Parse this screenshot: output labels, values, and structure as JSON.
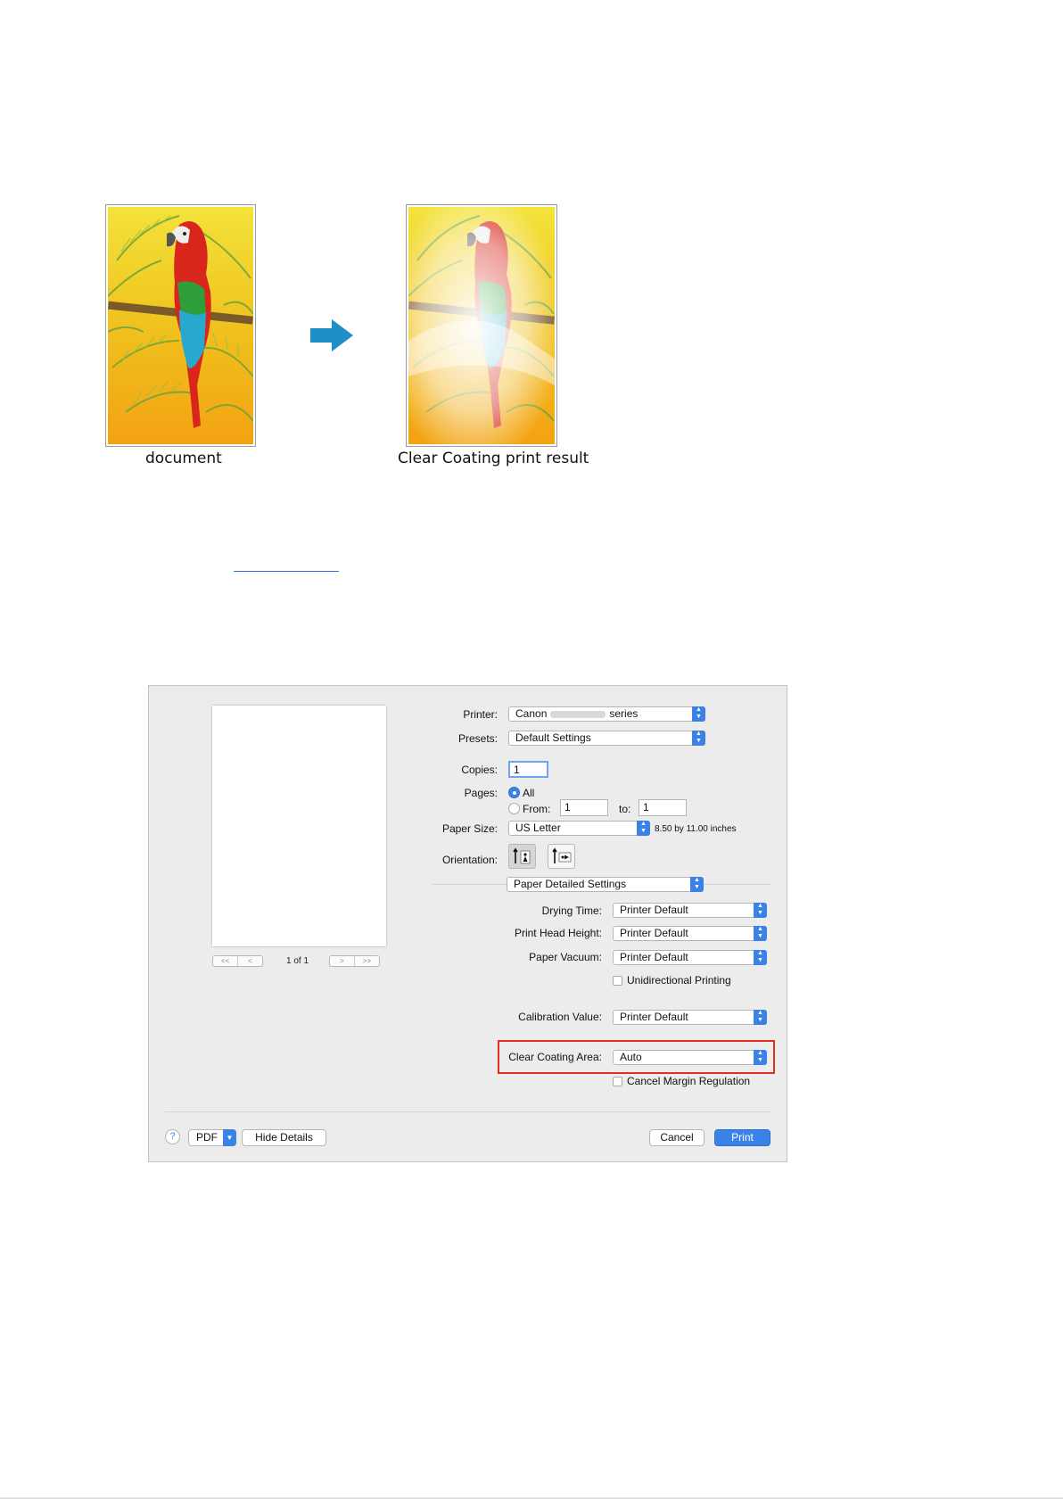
{
  "figure": {
    "caption_left": "document",
    "caption_right": "Clear Coating print result"
  },
  "dialog": {
    "printer": {
      "label": "Printer:",
      "value_prefix": "Canon",
      "value_suffix": "series"
    },
    "presets": {
      "label": "Presets:",
      "value": "Default Settings"
    },
    "copies": {
      "label": "Copies:",
      "value": "1"
    },
    "pages": {
      "label": "Pages:",
      "all_label": "All",
      "from_label": "From:",
      "from_value": "1",
      "to_label": "to:",
      "to_value": "1"
    },
    "paper_size": {
      "label": "Paper Size:",
      "value": "US Letter",
      "info": "8.50 by 11.00 inches"
    },
    "orientation": {
      "label": "Orientation:"
    },
    "panel_select": {
      "value": "Paper Detailed Settings"
    },
    "drying_time": {
      "label": "Drying Time:",
      "value": "Printer Default"
    },
    "print_head_height": {
      "label": "Print Head Height:",
      "value": "Printer Default"
    },
    "paper_vacuum": {
      "label": "Paper Vacuum:",
      "value": "Printer Default"
    },
    "unidirectional": {
      "label": "Unidirectional Printing"
    },
    "calibration": {
      "label": "Calibration Value:",
      "value": "Printer Default"
    },
    "clear_coating": {
      "label": "Clear Coating Area:",
      "value": "Auto"
    },
    "cancel_margin": {
      "label": "Cancel Margin Regulation"
    },
    "preview_nav": {
      "page_indicator": "1 of 1",
      "first": "<<",
      "prev": "<",
      "next": ">",
      "last": ">>"
    },
    "footer": {
      "help": "?",
      "pdf": "PDF",
      "hide_details": "Hide Details",
      "cancel": "Cancel",
      "print": "Print"
    }
  },
  "colors": {
    "accent": "#3b82e6",
    "highlight": "#e0301e",
    "link": "#3a6fd8"
  }
}
